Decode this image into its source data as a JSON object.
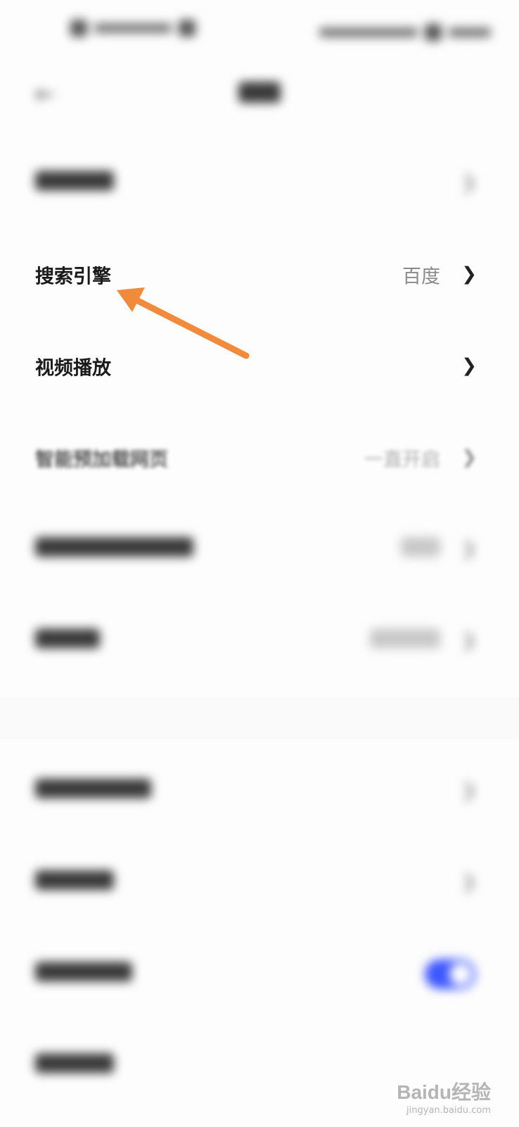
{
  "header": {
    "back_icon": "back-arrow-icon"
  },
  "rows": {
    "search_engine": {
      "label": "搜索引擎",
      "value": "百度",
      "chevron": "❯"
    },
    "video_playback": {
      "label": "视频播放",
      "chevron": "❯"
    },
    "smart_preload": {
      "label": "智能预加载网页",
      "value": "一直开启",
      "chevron": "❯"
    }
  },
  "toggle": {
    "state": "on",
    "color": "#3d56ff"
  },
  "annotation": {
    "arrow_color": "#f28a3b",
    "target": "搜索引擎"
  },
  "watermark": {
    "brand": "Baidu经验",
    "url": "jingyan.baidu.com"
  }
}
